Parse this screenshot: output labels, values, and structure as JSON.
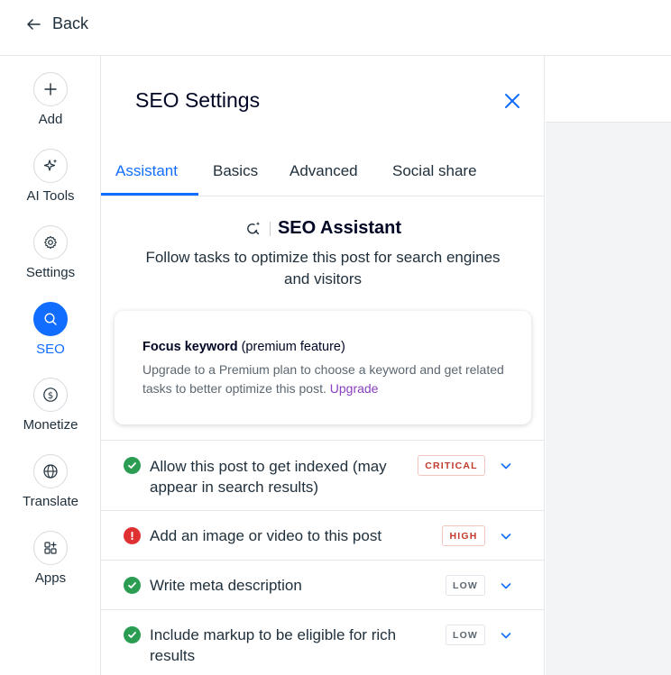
{
  "header": {
    "back_label": "Back"
  },
  "sidebar": {
    "items": [
      {
        "label": "Add",
        "icon": "plus-icon"
      },
      {
        "label": "AI Tools",
        "icon": "sparkles-icon"
      },
      {
        "label": "Settings",
        "icon": "gear-icon"
      },
      {
        "label": "SEO",
        "icon": "search-icon",
        "active": true
      },
      {
        "label": "Monetize",
        "icon": "dollar-icon"
      },
      {
        "label": "Translate",
        "icon": "globe-icon"
      },
      {
        "label": "Apps",
        "icon": "apps-icon"
      }
    ]
  },
  "panel": {
    "title": "SEO Settings",
    "tabs": [
      {
        "label": "Assistant",
        "active": true
      },
      {
        "label": "Basics"
      },
      {
        "label": "Advanced"
      },
      {
        "label": "Social share"
      }
    ],
    "assistant": {
      "title": "SEO Assistant",
      "description": "Follow tasks to optimize this post for search engines and visitors"
    },
    "focus_card": {
      "title_bold": "Focus keyword",
      "title_rest": " (premium feature)",
      "text": "Upgrade to a Premium plan to choose a keyword and get related tasks to better optimize this post. ",
      "link": "Upgrade"
    },
    "tasks": [
      {
        "text": "Allow this post to get indexed (may appear in search results)",
        "status": "done",
        "priority": "CRITICAL"
      },
      {
        "text": "Add an image or video to this post",
        "status": "error",
        "priority": "HIGH"
      },
      {
        "text": "Write meta description",
        "status": "done",
        "priority": "LOW"
      },
      {
        "text": "Include markup to be eligible for rich results",
        "status": "done",
        "priority": "LOW"
      }
    ]
  },
  "colors": {
    "accent": "#116dff",
    "success": "#2a9d53",
    "error": "#df3131",
    "upgrade_link": "#8a3fc0"
  }
}
